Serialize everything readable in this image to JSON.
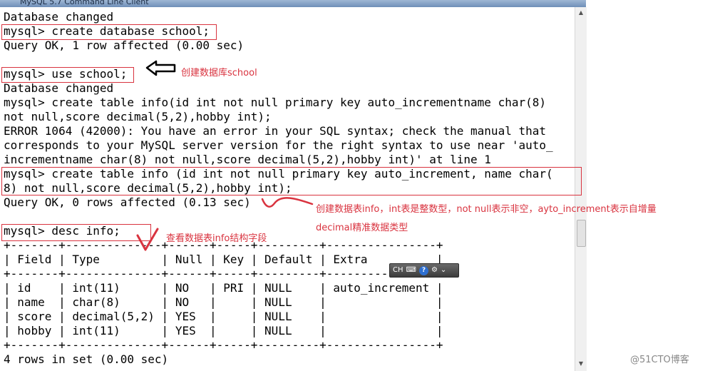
{
  "window": {
    "title": "MySQL 5.7 Command Line Client"
  },
  "console": {
    "lines": [
      "Database changed",
      "mysql> create database school;",
      "Query OK, 1 row affected (0.00 sec)",
      "",
      "mysql> use school;",
      "Database changed",
      "mysql> create table info(id int not null primary key auto_incrementname char(8)",
      "not null,score decimal(5,2),hobby int);",
      "ERROR 1064 (42000): You have an error in your SQL syntax; check the manual that",
      "corresponds to your MySQL server version for the right syntax to use near 'auto_",
      "incrementname char(8) not null,score decimal(5,2),hobby int)' at line 1",
      "mysql> create table info (id int not null primary key auto_increment, name char(",
      "8) not null,score decimal(5,2),hobby int);",
      "Query OK, 0 rows affected (0.13 sec)",
      "",
      "mysql> desc info;",
      "+-------+--------------+------+-----+---------+----------------+",
      "| Field | Type         | Null | Key | Default | Extra          |",
      "+-------+--------------+------+-----+---------+----------------+",
      "| id    | int(11)      | NO   | PRI | NULL    | auto_increment |",
      "| name  | char(8)      | NO   |     | NULL    |                |",
      "| score | decimal(5,2) | YES  |     | NULL    |                |",
      "| hobby | int(11)      | YES  |     | NULL    |                |",
      "+-------+--------------+------+-----+---------+----------------+",
      "4 rows in set (0.00 sec)"
    ]
  },
  "annotations": {
    "create_db": "创建数据库school",
    "create_table_line1": "创建数据表info，int表是整数型，not  null表示非空，ayto_increment表示自增量",
    "create_table_line2": "decimal精准数据类型",
    "desc": "查看数据表info结构字段"
  },
  "ime": {
    "lang": "CH"
  },
  "watermark": "@51CTO博客",
  "colors": {
    "annotation": "#d9333f",
    "console_bg": "#ffffff",
    "text": "#000000"
  }
}
